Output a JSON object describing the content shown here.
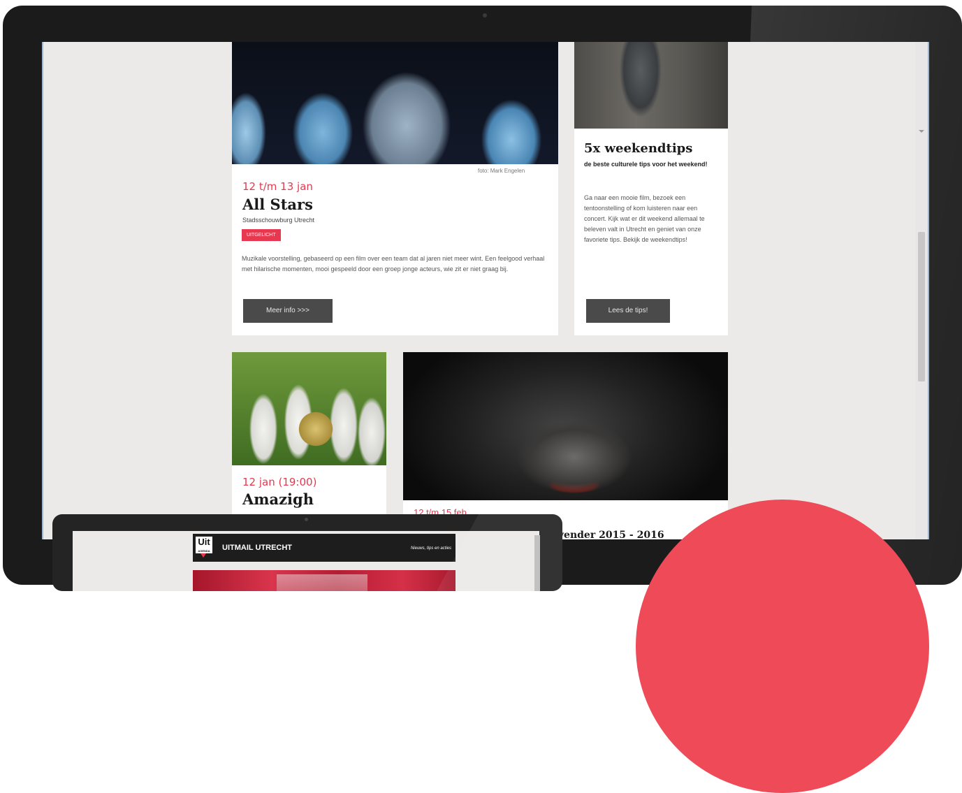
{
  "cards": {
    "all_stars": {
      "photo_credit": "foto: Mark Engelen",
      "date": "12 t/m 13 jan",
      "title": "All Stars",
      "venue": "Stadsschouwburg Utrecht",
      "badge": "UITGELICHT",
      "description": "Muzikale voorstelling, gebaseerd op een film over een team dat al jaren niet meer wint. Een feelgood verhaal met hilarische momenten, mooi gespeeld door een groep jonge acteurs, wie zit er niet graag bij.",
      "button_label": "Meer info >>>"
    },
    "weekend": {
      "title": "5x weekendtips",
      "lead": "de beste culturele tips voor het weekend!",
      "description": "Ga naar een mooie film, bezoek een tentoonstelling of kom luisteren naar een concert. Kijk wat er dit weekend allemaal te beleven valt in Utrecht en geniet van onze favoriete tips. Bekijk de weekendtips!",
      "button_label": "Lees de tips!"
    },
    "amazigh": {
      "date": "12 jan (19:00)",
      "title": "Amazigh"
    },
    "band": {
      "date": "12 t/m 15 feb",
      "title": "Lavender 2015 - 2016"
    }
  },
  "tablet": {
    "logo_text": "Uit",
    "logo_sub": "AGENDA",
    "title": "UITMAIL UTRECHT",
    "tagline": "Nieuws, tips en acties"
  },
  "colors": {
    "accent": "#e8384f",
    "button": "#4a4a4a",
    "page_bg": "#ece9e9",
    "circle": "#ef4a57"
  }
}
